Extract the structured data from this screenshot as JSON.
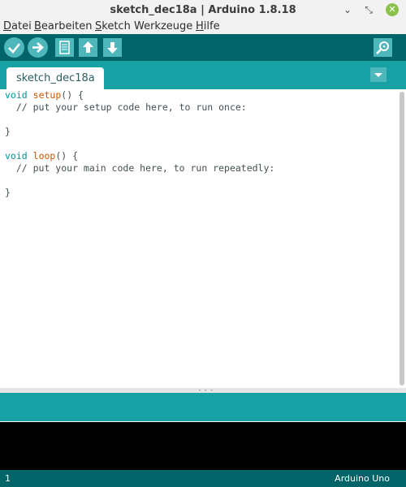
{
  "window": {
    "title": "sketch_dec18a | Arduino 1.8.18",
    "minimize_glyph": "⌄",
    "maximize_glyph": "⤡",
    "close_glyph": "✕"
  },
  "menu": {
    "items": [
      {
        "label": "Datei",
        "mnemonic": "D"
      },
      {
        "label": "Bearbeiten",
        "mnemonic": "B"
      },
      {
        "label": "Sketch",
        "mnemonic": "S"
      },
      {
        "label": "Werkzeuge",
        "mnemonic": "W"
      },
      {
        "label": "Hilfe",
        "mnemonic": "H"
      }
    ]
  },
  "toolbar": {
    "buttons": [
      {
        "name": "verify",
        "icon": "check-icon"
      },
      {
        "name": "upload",
        "icon": "arrow-right-icon"
      },
      {
        "name": "new",
        "icon": "new-file-icon"
      },
      {
        "name": "open",
        "icon": "arrow-up-icon"
      },
      {
        "name": "save",
        "icon": "arrow-down-icon"
      },
      {
        "name": "serial-monitor",
        "icon": "magnifier-icon"
      }
    ]
  },
  "tabs": [
    {
      "label": "sketch_dec18a",
      "active": true
    }
  ],
  "editor": {
    "lines": [
      {
        "kw": "void",
        "fn": "setup",
        "rest": "() {"
      },
      {
        "comment": "  // put your setup code here, to run once:"
      },
      {
        "comment": ""
      },
      {
        "plain": "}"
      },
      {
        "comment": ""
      },
      {
        "kw": "void",
        "fn": "loop",
        "rest": "() {"
      },
      {
        "comment": "  // put your main code here, to run repeatedly:"
      },
      {
        "comment": ""
      },
      {
        "plain": "}"
      }
    ]
  },
  "status": {
    "line_number": "1",
    "board": "Arduino Uno"
  },
  "colors": {
    "toolbar_bg": "#006468",
    "tab_strip_bg": "#17a1a5",
    "button_bg": "#4db7bb",
    "keyword": "#00979c",
    "function": "#d35400",
    "console_bg": "#000000",
    "close_button": "#8bc34a"
  }
}
